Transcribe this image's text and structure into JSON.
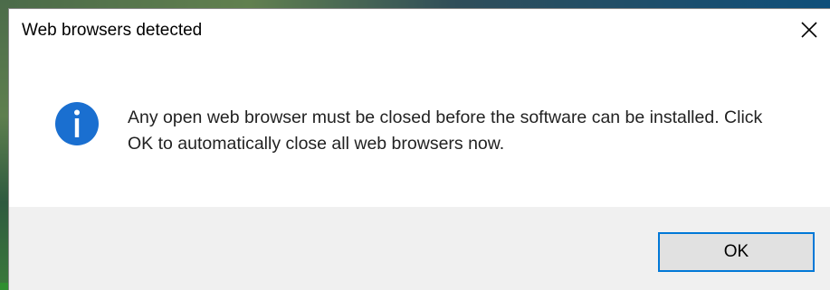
{
  "dialog": {
    "title": "Web browsers detected",
    "message": "Any open web browser must be closed before the software can be installed. Click OK to automatically close all web browsers now.",
    "icon": "info-icon",
    "close_icon": "close-icon",
    "ok_label": "OK"
  },
  "colors": {
    "info_icon": "#1a6fd0",
    "focus_border": "#0078d7",
    "footer_bg": "#f0f0f0"
  }
}
